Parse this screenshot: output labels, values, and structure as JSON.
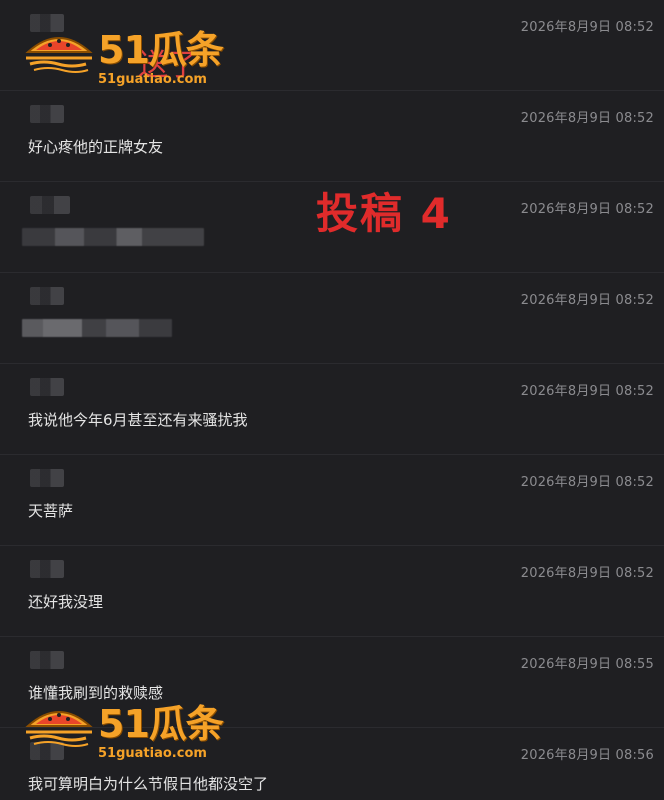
{
  "messages": [
    {
      "time": "2026年8月9日 08:52",
      "text": ""
    },
    {
      "time": "2026年8月9日 08:52",
      "text": "好心疼他的正牌女友"
    },
    {
      "time": "2026年8月9日 08:52",
      "text": ""
    },
    {
      "time": "2026年8月9日 08:52",
      "text": ""
    },
    {
      "time": "2026年8月9日 08:52",
      "text": "我说他今年6月甚至还有来骚扰我"
    },
    {
      "time": "2026年8月9日 08:52",
      "text": "天菩萨"
    },
    {
      "time": "2026年8月9日 08:52",
      "text": "还好我没理"
    },
    {
      "time": "2026年8月9日 08:55",
      "text": "谁懂我刷到的救赎感"
    },
    {
      "time": "2026年8月9日 08:56",
      "text": "我可算明白为什么节假日他都没空了"
    }
  ],
  "overlay_partial_text": "送了",
  "stamp": "投稿 4",
  "watermark": {
    "title": "51瓜条",
    "url": "51guatiao.com",
    "color": "#f5a228"
  },
  "icons": [
    "watermelon-logo-icon"
  ]
}
